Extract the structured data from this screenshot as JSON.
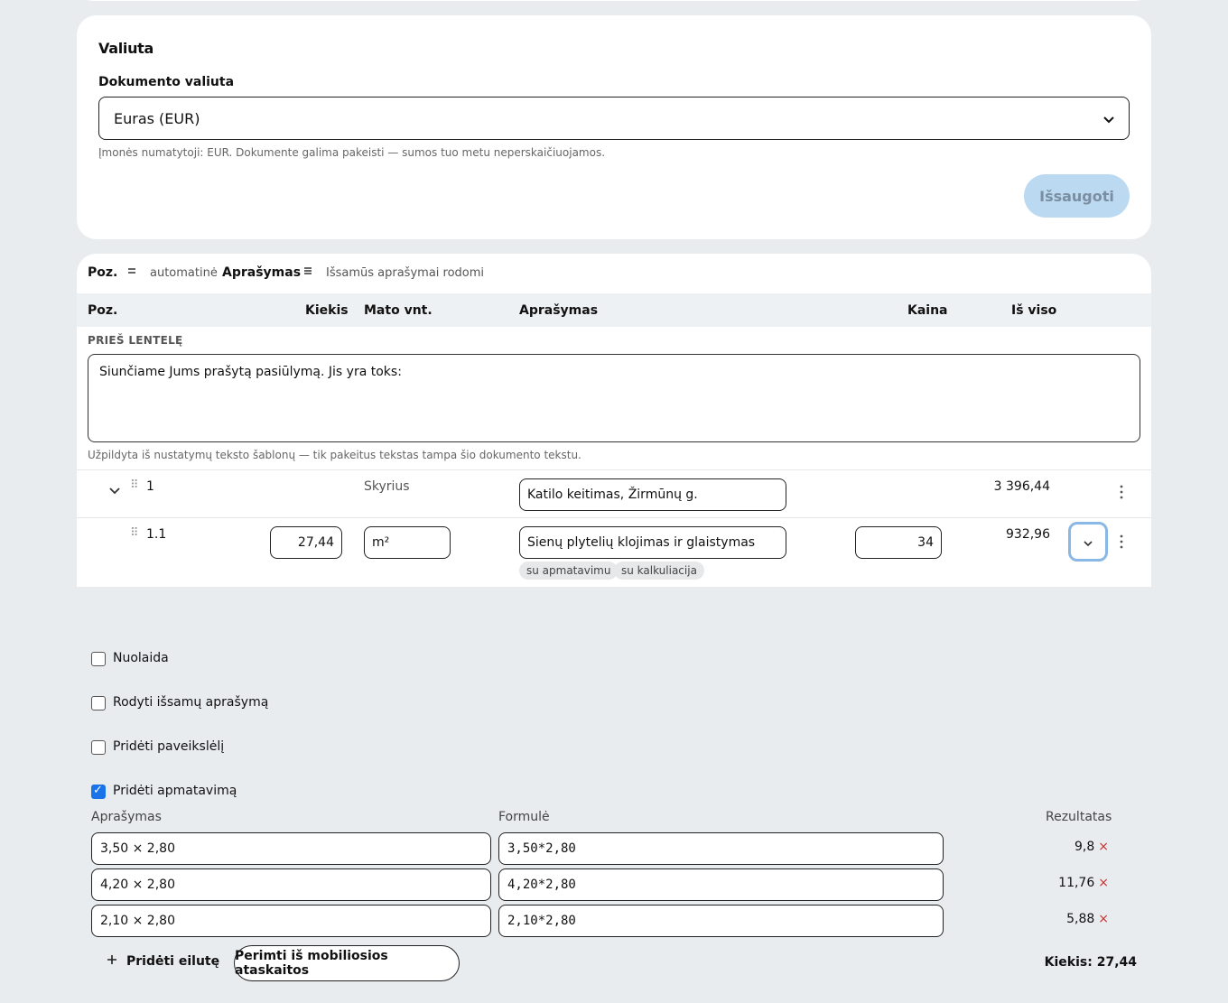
{
  "currency": {
    "title": "Valiuta",
    "label": "Dokumento valiuta",
    "selected": "Euras (EUR)",
    "hint": "Įmonės numatytoji: EUR. Dokumente galima pakeisti — sumos tuo metu neperskaičiuojamos.",
    "save_label": "Išsaugoti"
  },
  "toolbar": {
    "poz_label": "Poz.",
    "poz_mode_icon": "equals-icon",
    "poz_mode": "automatinė",
    "desc_label": "Aprašymas",
    "desc_mode_icon": "lines-icon",
    "desc_mode": "Išsamūs aprašymai rodomi"
  },
  "table": {
    "headers": [
      "Poz.",
      "Kiekis",
      "Mato vnt.",
      "Aprašymas",
      "Kaina",
      "Iš viso"
    ],
    "before_label": "PRIEŠ LENTELĘ",
    "before_text": "Siunčiame Jums prašytą pasiūlymą. Jis yra toks:",
    "before_hint": "Užpildyta iš nustatymų teksto šablonų — tik pakeitus tekstas tampa šio dokumento tekstu.",
    "section": {
      "pos": "1",
      "unit": "Skyrius",
      "description": "Katilo keitimas, Žirmūnų g.",
      "total": "3 396,44"
    },
    "item": {
      "pos": "1.1",
      "qty": "27,44",
      "unit": "m²",
      "description": "Sienų plytelių klojimas ir glaistymas",
      "price": "34",
      "total": "932,96",
      "tags": [
        "su apmatavimu",
        "su kalkuliacija"
      ]
    }
  },
  "options": [
    {
      "label": "Nuolaida",
      "checked": false
    },
    {
      "label": "Rodyti išsamų aprašymą",
      "checked": false
    },
    {
      "label": "Pridėti paveikslėlį",
      "checked": false
    },
    {
      "label": "Pridėti apmatavimą",
      "checked": true
    }
  ],
  "measurements": {
    "headers": {
      "desc": "Aprašymas",
      "formula": "Formulė",
      "result": "Rezultatas"
    },
    "rows": [
      {
        "desc": "3,50 × 2,80",
        "formula": "3,50*2,80",
        "result": "9,8"
      },
      {
        "desc": "4,20 × 2,80",
        "formula": "4,20*2,80",
        "result": "11,76"
      },
      {
        "desc": "2,10 × 2,80",
        "formula": "2,10*2,80",
        "result": "5,88"
      }
    ],
    "remove_glyph": "×",
    "add_row_label": "Pridėti eilutę",
    "import_label": "Perimti iš mobiliosios ataskaitos",
    "qty_summary": "Kiekis: 27,44"
  }
}
